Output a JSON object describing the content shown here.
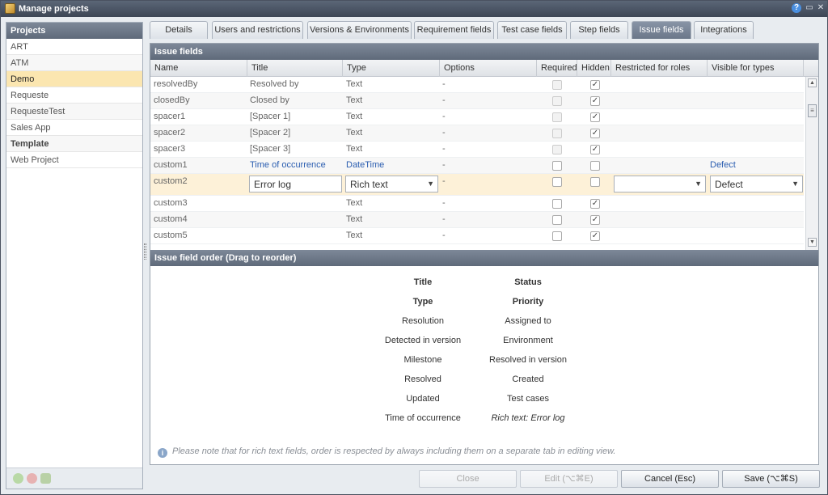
{
  "window": {
    "title": "Manage projects"
  },
  "projects": {
    "header": "Projects",
    "items": [
      {
        "label": "ART"
      },
      {
        "label": "ATM"
      },
      {
        "label": "Demo"
      },
      {
        "label": "Requeste"
      },
      {
        "label": "RequesteTest"
      },
      {
        "label": "Sales App"
      },
      {
        "label": "Template"
      },
      {
        "label": "Web Project"
      }
    ],
    "selected": "Demo"
  },
  "tabs": [
    "Details",
    "Users and restrictions",
    "Versions & Environments",
    "Requirement fields",
    "Test case fields",
    "Step fields",
    "Issue fields",
    "Integrations"
  ],
  "active_tab": "Issue fields",
  "issue_fields": {
    "header": "Issue fields",
    "columns": [
      "Name",
      "Title",
      "Type",
      "Options",
      "Required",
      "Hidden",
      "Restricted for roles",
      "Visible for types"
    ],
    "rows": [
      {
        "name": "resolvedBy",
        "title": "Resolved by",
        "type": "Text",
        "options": "-",
        "required": false,
        "hidden": true,
        "required_disabled": true
      },
      {
        "name": "closedBy",
        "title": "Closed by",
        "type": "Text",
        "options": "-",
        "required": false,
        "hidden": true,
        "required_disabled": true
      },
      {
        "name": "spacer1",
        "title": "[Spacer 1]",
        "type": "Text",
        "options": "-",
        "required": false,
        "hidden": true,
        "required_disabled": true
      },
      {
        "name": "spacer2",
        "title": "[Spacer 2]",
        "type": "Text",
        "options": "-",
        "required": false,
        "hidden": true,
        "required_disabled": true
      },
      {
        "name": "spacer3",
        "title": "[Spacer 3]",
        "type": "Text",
        "options": "-",
        "required": false,
        "hidden": true,
        "required_disabled": true
      },
      {
        "name": "custom1",
        "title": "Time of occurrence",
        "type": "DateTime",
        "options": "-",
        "required": false,
        "hidden": false,
        "visible_for": "Defect"
      },
      {
        "name": "custom2",
        "title": "Error log",
        "type": "Rich text",
        "options": "-",
        "required": false,
        "hidden": false,
        "restricted": "",
        "visible_for": "Defect",
        "editing": true
      },
      {
        "name": "custom3",
        "title": "",
        "type": "Text",
        "options": "-",
        "required": false,
        "hidden": true
      },
      {
        "name": "custom4",
        "title": "",
        "type": "Text",
        "options": "-",
        "required": false,
        "hidden": true
      },
      {
        "name": "custom5",
        "title": "",
        "type": "Text",
        "options": "-",
        "required": false,
        "hidden": true
      }
    ]
  },
  "field_order": {
    "header": "Issue field order (Drag to reorder)",
    "left": [
      "Title",
      "Type",
      "Resolution",
      "Detected in version",
      "Milestone",
      "Resolved",
      "Updated",
      "Time of occurrence"
    ],
    "right": [
      "Status",
      "Priority",
      "Assigned to",
      "Environment",
      "Resolved in version",
      "Created",
      "Test cases",
      "Rich text: Error log"
    ],
    "note": "Please note that for rich text fields, order is respected by always including them on a separate tab in editing view."
  },
  "buttons": {
    "close": "Close",
    "edit": "Edit (⌥⌘E)",
    "cancel": "Cancel (Esc)",
    "save": "Save (⌥⌘S)"
  }
}
